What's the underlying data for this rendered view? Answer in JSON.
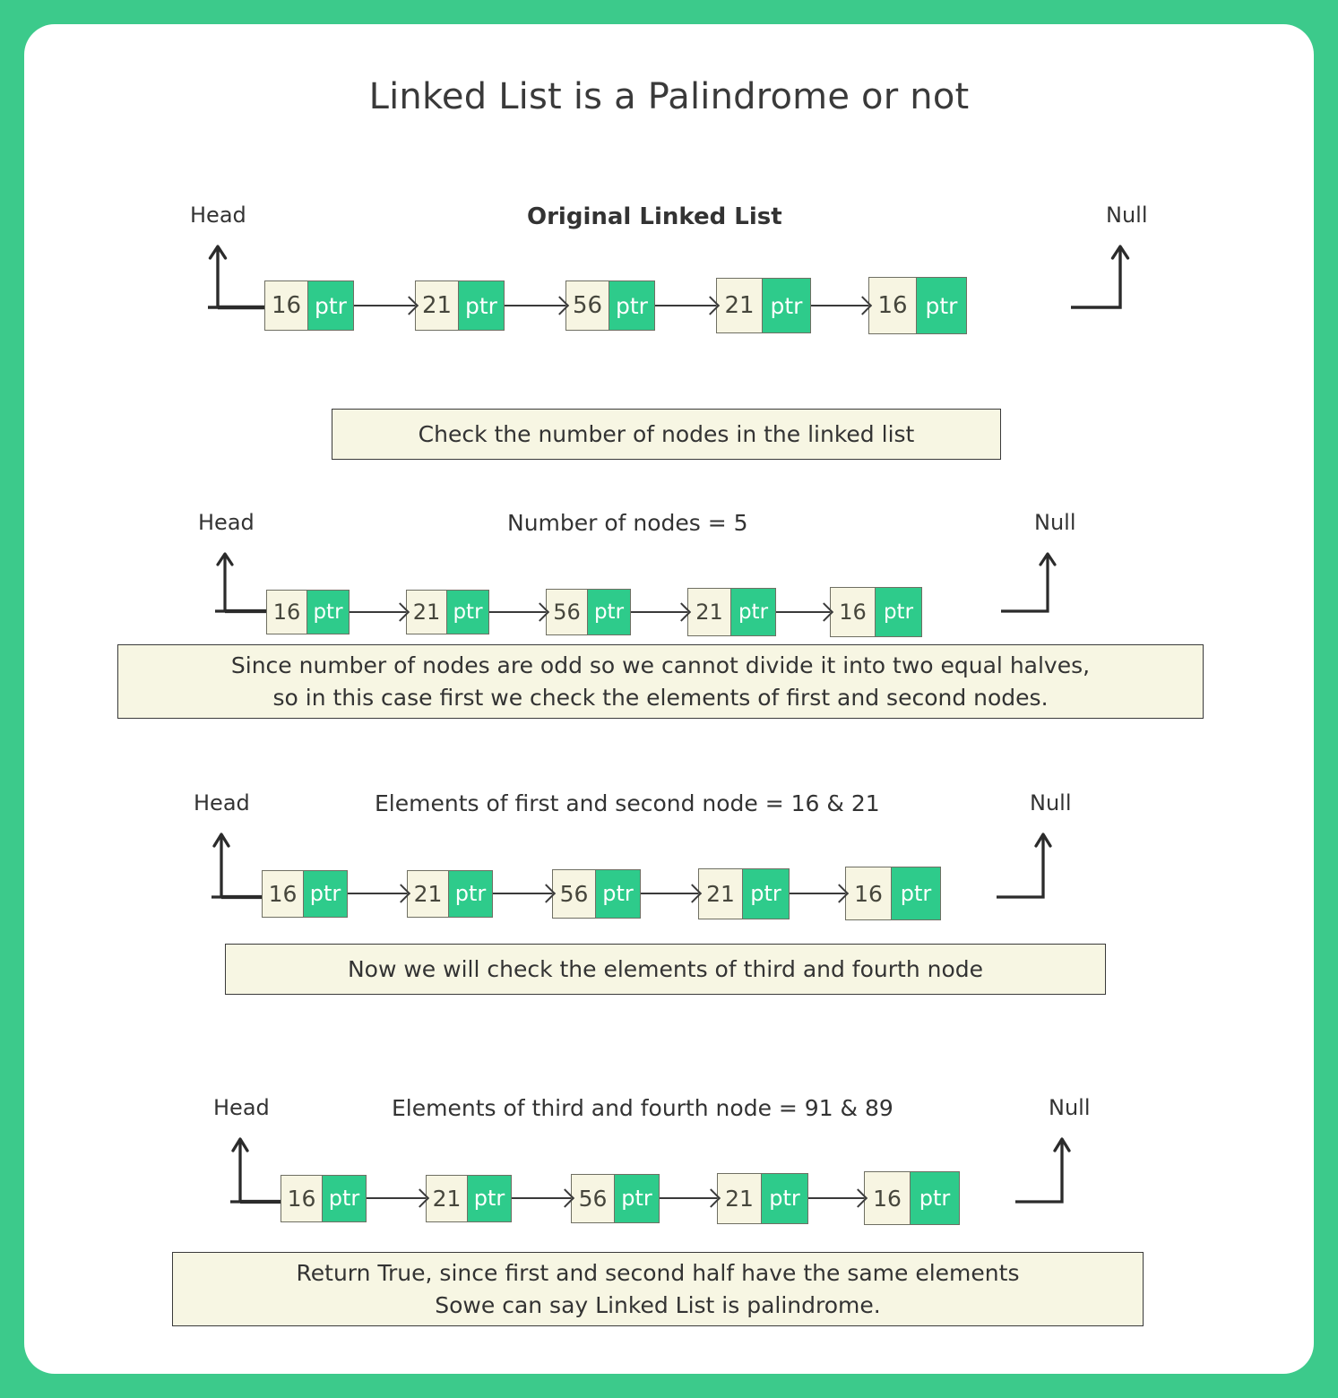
{
  "page": {
    "title": "Linked List is a Palindrome or not",
    "frame_color": "#3cca8b",
    "node_value_color": "#f7f5e2",
    "node_ptr_color": "#2ecb8b",
    "box_fill_color": "#f7f6e3"
  },
  "labels": {
    "head": "Head",
    "null": "Null",
    "ptr": "ptr"
  },
  "rows": [
    {
      "caption": "Original Linked List",
      "head": "Head",
      "null": "Null",
      "nodes": [
        {
          "value": "16",
          "ptr": "ptr"
        },
        {
          "value": "21",
          "ptr": "ptr"
        },
        {
          "value": "56",
          "ptr": "ptr"
        },
        {
          "value": "21",
          "ptr": "ptr"
        },
        {
          "value": "16",
          "ptr": "ptr"
        }
      ]
    },
    {
      "caption": "Number of nodes = 5",
      "head": "Head",
      "null": "Null",
      "nodes": [
        {
          "value": "16",
          "ptr": "ptr"
        },
        {
          "value": "21",
          "ptr": "ptr"
        },
        {
          "value": "56",
          "ptr": "ptr"
        },
        {
          "value": "21",
          "ptr": "ptr"
        },
        {
          "value": "16",
          "ptr": "ptr"
        }
      ]
    },
    {
      "caption": "Elements of first and second node = 16 & 21",
      "head": "Head",
      "null": "Null",
      "nodes": [
        {
          "value": "16",
          "ptr": "ptr"
        },
        {
          "value": "21",
          "ptr": "ptr"
        },
        {
          "value": "56",
          "ptr": "ptr"
        },
        {
          "value": "21",
          "ptr": "ptr"
        },
        {
          "value": "16",
          "ptr": "ptr"
        }
      ]
    },
    {
      "caption": "Elements of third and fourth node = 91 & 89",
      "head": "Head",
      "null": "Null",
      "nodes": [
        {
          "value": "16",
          "ptr": "ptr"
        },
        {
          "value": "21",
          "ptr": "ptr"
        },
        {
          "value": "56",
          "ptr": "ptr"
        },
        {
          "value": "21",
          "ptr": "ptr"
        },
        {
          "value": "16",
          "ptr": "ptr"
        }
      ]
    }
  ],
  "messages": [
    {
      "lines": [
        "Check the number of nodes in the linked list"
      ]
    },
    {
      "lines": [
        "Since number of nodes are odd so we cannot divide it into two equal halves,",
        "so in this case first we check the elements of first and second nodes."
      ]
    },
    {
      "lines": [
        "Now we will check the elements of third and fourth node"
      ]
    },
    {
      "lines": [
        "Return True, since first and second half have the same elements",
        "Sowe can say Linked List is palindrome."
      ]
    }
  ]
}
